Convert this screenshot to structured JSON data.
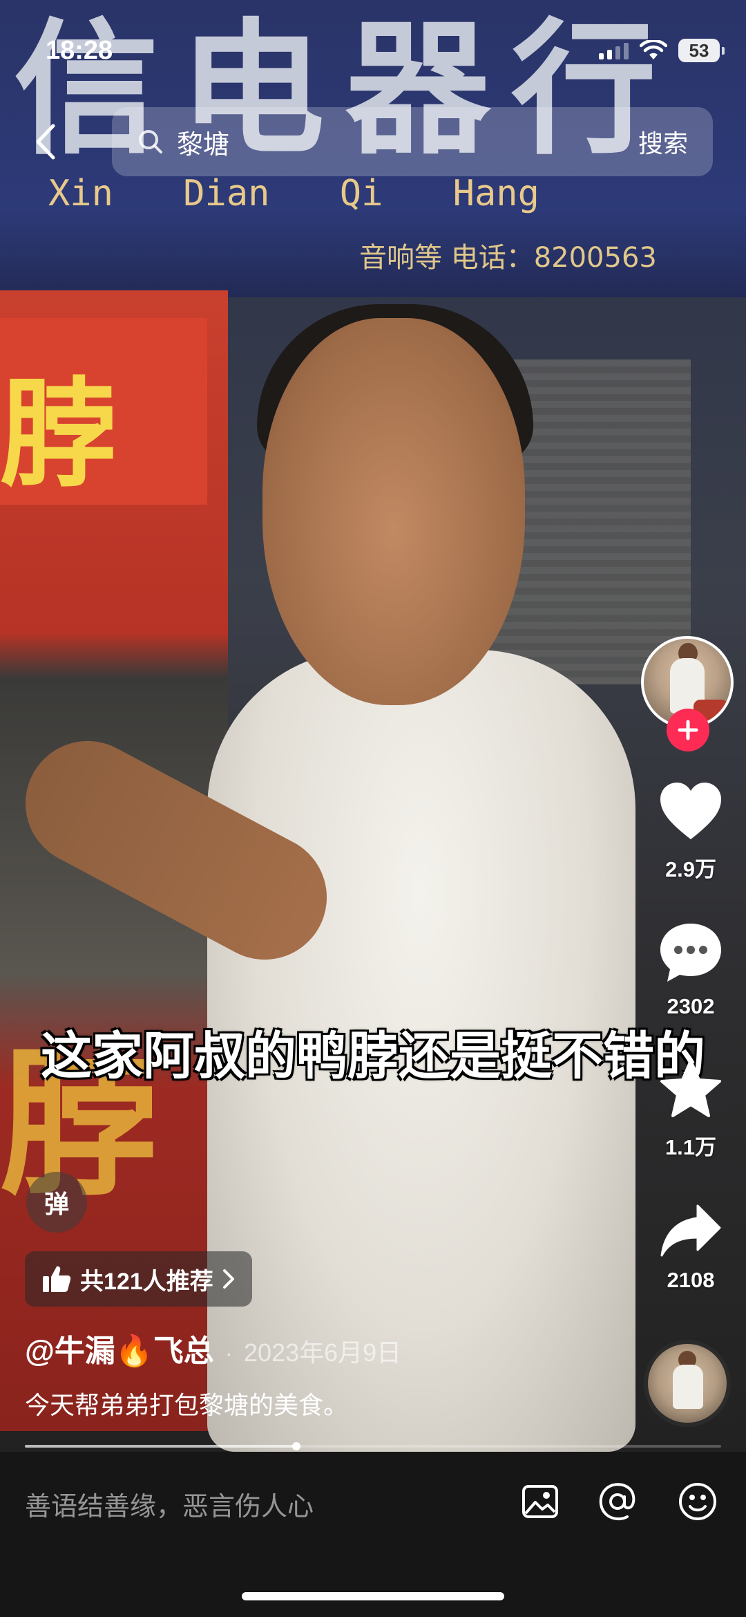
{
  "status_bar": {
    "time": "18:28",
    "battery": "53"
  },
  "search": {
    "query": "黎塘",
    "submit_label": "搜索"
  },
  "scene": {
    "sign_characters": "信电器行",
    "sign_pinyin": "Xin Dian Qi Hang",
    "sign_phone": "音响等  电话：8200563",
    "stall_character": "脖"
  },
  "subtitle": "这家阿叔的鸭脖还是挺不错的",
  "actions": {
    "like_count": "2.9万",
    "comment_count": "2302",
    "favorite_count": "1.1万",
    "share_count": "2108"
  },
  "danmaku_label": "弹",
  "recommend": {
    "text": "共121人推荐"
  },
  "post": {
    "author": "@牛漏🔥飞总",
    "separator": "·",
    "date": "2023年6月9日",
    "caption": "今天帮弟弟打包黎塘的美食。"
  },
  "playback_progress_percent": 39,
  "comment_bar": {
    "placeholder": "善语结善缘，恶言伤人心"
  },
  "colors": {
    "accent_pink": "#fe2c55",
    "comment_bar_bg": "#161616"
  },
  "icons": {
    "back": "chevron-left-icon",
    "search": "search-icon",
    "follow": "plus-icon",
    "like": "heart-icon",
    "comment": "comment-bubble-icon",
    "favorite": "star-icon",
    "share": "share-arrow-icon",
    "recommend": "thumbs-up-icon",
    "image": "image-icon",
    "mention": "at-icon",
    "emoji": "emoji-icon"
  }
}
